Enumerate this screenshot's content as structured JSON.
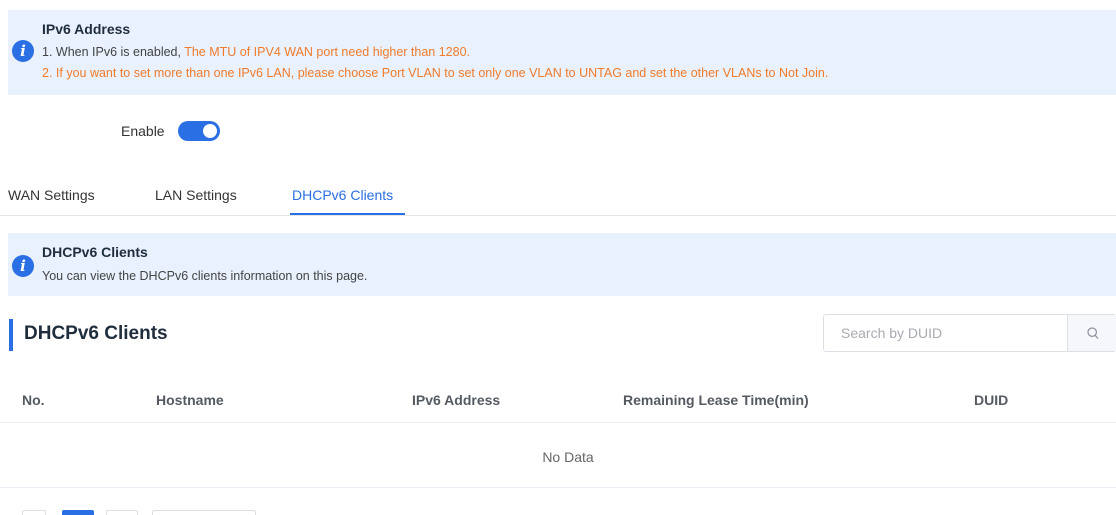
{
  "banner_top": {
    "icon": "info-icon",
    "title": "IPv6 Address",
    "line1_prefix": "1. When IPv6 is enabled, ",
    "line1_highlight": "The MTU of IPV4 WAN port need higher than 1280.",
    "line2": "2. If you want to set more than one IPv6 LAN, please choose Port VLAN to set only one VLAN to UNTAG and set the other VLANs to Not Join."
  },
  "enable": {
    "label": "Enable",
    "state": "on"
  },
  "tabs": [
    {
      "label": "WAN Settings",
      "active": false
    },
    {
      "label": "LAN Settings",
      "active": false
    },
    {
      "label": "DHCPv6 Clients",
      "active": true
    }
  ],
  "banner_mid": {
    "icon": "info-icon",
    "title": "DHCPv6 Clients",
    "text": "You can view the DHCPv6 clients information on this page."
  },
  "section": {
    "title": "DHCPv6 Clients"
  },
  "search": {
    "placeholder": "Search by DUID",
    "value": "",
    "icon": "search-icon"
  },
  "table": {
    "columns": [
      "No.",
      "Hostname",
      "IPv6 Address",
      "Remaining Lease Time(min)",
      "DUID"
    ],
    "rows": [],
    "empty_text": "No Data"
  },
  "colors": {
    "accent": "#2a6fe3",
    "warning": "#f07b2b",
    "banner_bg": "#e8f1fd"
  }
}
